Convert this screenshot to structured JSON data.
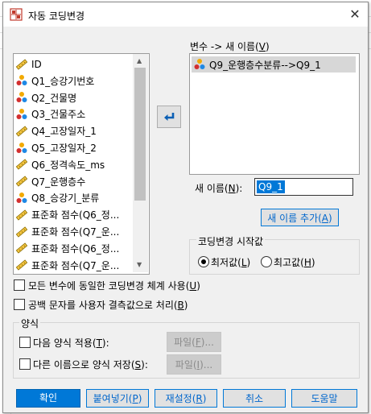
{
  "dialog": {
    "title": "자동 코딩변경",
    "close_glyph": "✕"
  },
  "source_vars": {
    "items": [
      {
        "label": "ID",
        "type": "scale"
      },
      {
        "label": "Q1_승강기번호",
        "type": "nominal"
      },
      {
        "label": "Q2_건물명",
        "type": "nominal"
      },
      {
        "label": "Q3_건물주소",
        "type": "nominal"
      },
      {
        "label": "Q4_고장일자_1",
        "type": "scale"
      },
      {
        "label": "Q5_고장일자_2",
        "type": "nominal"
      },
      {
        "label": "Q6_정격속도_ms",
        "type": "scale"
      },
      {
        "label": "Q7_운행층수",
        "type": "scale"
      },
      {
        "label": "Q8_승강기_분류",
        "type": "nominal"
      },
      {
        "label": "표준화 점수(Q6_정...",
        "type": "scale"
      },
      {
        "label": "표준화 점수(Q7_운...",
        "type": "scale"
      },
      {
        "label": "표준화 점수(Q6_정...",
        "type": "scale"
      },
      {
        "label": "표준화 점수(Q7_운...",
        "type": "scale"
      }
    ]
  },
  "move_arrow": "⮨",
  "mapping": {
    "label": "변수 -> 새 이름(",
    "label_key": "V",
    "label_end": ")",
    "items": [
      {
        "label": "Q9_운행층수분류-->Q9_1",
        "type": "nominal"
      }
    ]
  },
  "new_name": {
    "label": "새 이름(",
    "label_key": "N",
    "label_end": "):",
    "value": "Q9_1",
    "add_button_pre": "새 이름 추가(",
    "add_button_key": "A",
    "add_button_end": ")"
  },
  "recode_start": {
    "legend": "코딩변경 시작값",
    "options": [
      {
        "pre": "최저값(",
        "key": "L",
        "end": ")",
        "selected": true
      },
      {
        "pre": "최고값(",
        "key": "H",
        "end": ")",
        "selected": false
      }
    ]
  },
  "checkboxes": [
    {
      "pre": "모든 변수에 동일한 코딩변경 체계 사용(",
      "key": "U",
      "end": ")"
    },
    {
      "pre": "공백 문자를 사용자 결측값으로 처리(",
      "key": "B",
      "end": ")"
    }
  ],
  "template": {
    "legend": "양식",
    "rows": [
      {
        "pre": "다음 양식 적용(",
        "key": "T",
        "end": "):",
        "button_pre": "파일(",
        "button_key": "F",
        "button_end": ")..."
      },
      {
        "pre": "다른 이름으로 양식 저장(",
        "key": "S",
        "end": "):",
        "button_pre": "파일(",
        "button_key": "I",
        "button_end": ")..."
      }
    ]
  },
  "buttons": {
    "ok": "확인",
    "paste_pre": "붙여넣기(",
    "paste_key": "P",
    "paste_end": ")",
    "reset_pre": "재설정(",
    "reset_key": "R",
    "reset_end": ")",
    "cancel": "취소",
    "help": "도움말"
  },
  "colors": {
    "accent": "#0078d7",
    "selection": "#cce8ff",
    "name_field_bg": "#0078d7"
  }
}
